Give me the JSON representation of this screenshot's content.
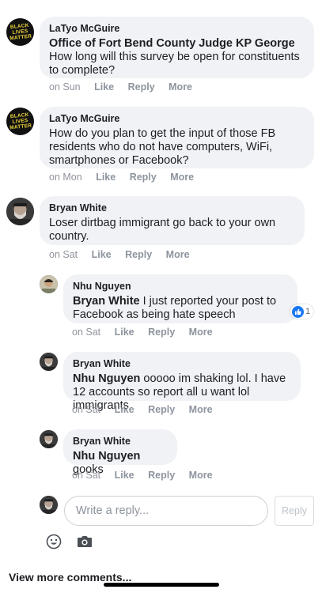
{
  "comments": [
    {
      "author": "LaTyo McGuire",
      "mention": "Office of Fort Bend County Judge KP George",
      "text": "How long will this survey be open for constituents to complete?",
      "time": "on Sun",
      "actions": [
        "Like",
        "Reply",
        "More"
      ],
      "avatar_text": "BLACK LIVES MATTER"
    },
    {
      "author": "LaTyo McGuire",
      "mention": "",
      "text": "How do you plan to get the input of those FB residents who do not have computers, WiFi, smartphones or Facebook?",
      "time": "on Mon",
      "actions": [
        "Like",
        "Reply",
        "More"
      ],
      "avatar_text": "BLACK LIVES MATTER"
    },
    {
      "author": "Bryan White",
      "mention": "",
      "text": "Loser dirtbag immigrant go back to your own country.",
      "time": "on Sat",
      "actions": [
        "Like",
        "Reply",
        "More"
      ]
    }
  ],
  "replies": [
    {
      "author": "Nhu Nguyen",
      "mention": "Bryan White",
      "text": "I just reported your post to Facebook as being hate speech",
      "time": "on Sat",
      "actions": [
        "Like",
        "Reply",
        "More"
      ],
      "reaction_count": "1"
    },
    {
      "author": "Bryan White",
      "mention": "Nhu Nguyen",
      "text": "ooooo im shaking lol. I have 12 accounts so report all u want lol immigrants",
      "time": "on Sat",
      "actions": [
        "Like",
        "Reply",
        "More"
      ]
    },
    {
      "author": "Bryan White",
      "mention": "Nhu Nguyen",
      "text": "gooks",
      "time": "on Sat",
      "actions": [
        "Like",
        "Reply",
        "More"
      ]
    }
  ],
  "composer": {
    "placeholder": "Write a reply...",
    "reply_label": "Reply",
    "icons": [
      "emoji-icon",
      "camera-icon"
    ]
  },
  "footer": {
    "view_more": "View more comments..."
  },
  "colors": {
    "bubble": "#f0f2f5",
    "meta_text": "#90949c",
    "like_blue": "#1877f2",
    "blm_yellow": "#e9d23a"
  }
}
